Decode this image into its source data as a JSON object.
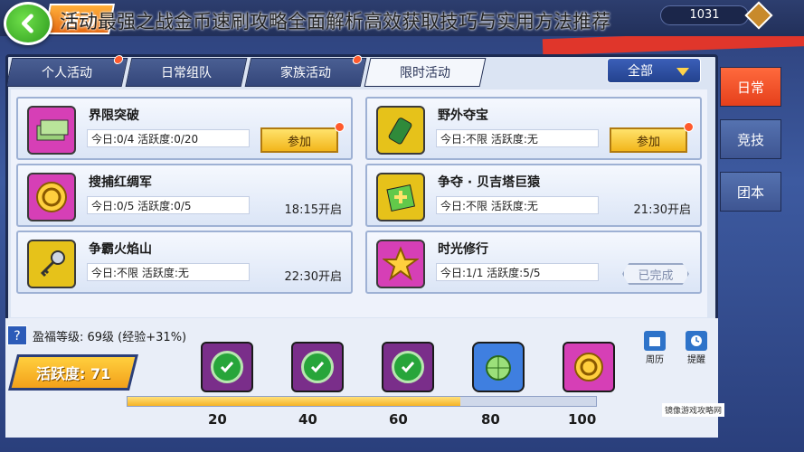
{
  "header": {
    "title": "活动最强之战金币速刷攻略全面解析高效获取技巧与实用方法推荐",
    "badge_label": "活动",
    "currency": "1031"
  },
  "tabs": [
    {
      "label": "个人活动",
      "has_dot": true
    },
    {
      "label": "日常组队",
      "has_dot": false
    },
    {
      "label": "家族活动",
      "has_dot": true
    },
    {
      "label": "限时活动",
      "has_dot": false
    }
  ],
  "filter": {
    "label": "全部"
  },
  "side_tabs": [
    {
      "label": "日常"
    },
    {
      "label": "竞技"
    },
    {
      "label": "团本"
    }
  ],
  "activities": [
    {
      "name": "界限突破",
      "stats": "今日:0/4   活跃度:0/20",
      "action": "参加",
      "icon": "cash-stack-icon"
    },
    {
      "name": "野外夺宝",
      "stats": "今日:不限   活跃度:无",
      "action": "参加",
      "icon": "treasure-bottle-icon"
    },
    {
      "name": "搜捕红绸军",
      "stats": "今日:0/5   活跃度:0/5",
      "time": "18:15开启",
      "icon": "gold-coin-icon"
    },
    {
      "name": "争夺 · 贝吉塔巨猿",
      "stats": "今日:不限   活跃度:无",
      "time": "21:30开启",
      "icon": "gift-box-icon"
    },
    {
      "name": "争霸火焰山",
      "stats": "今日:不限   活跃度:无",
      "time": "22:30开启",
      "icon": "key-icon"
    },
    {
      "name": "时光修行",
      "stats": "今日:1/1   活跃度:5/5",
      "status": "已完成",
      "icon": "experience-star-icon"
    }
  ],
  "bottom": {
    "level_text": "盈福等级: 69级 (经验+31%)",
    "activity_label": "活跃度: 71",
    "activity_value": 71,
    "milestones": [
      "20",
      "40",
      "60",
      "80",
      "100"
    ],
    "calendar_label": "周历",
    "reminder_label": "提醒",
    "watermark_text": "镜像游戏攻略网"
  },
  "colors": {
    "accent": "#e5401b",
    "primary": "#3e5592",
    "gold": "#f2b51b"
  }
}
